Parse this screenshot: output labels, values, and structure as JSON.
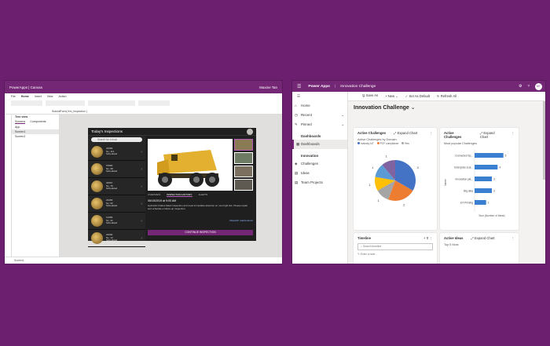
{
  "studio": {
    "title": "PowerApps | Canvas",
    "user": "Maxine Tan",
    "menu": [
      "File",
      "Home",
      "Insert",
      "View",
      "Action"
    ],
    "formula": "SubmitForm( frm_Inspection )",
    "tree_title": "Tree view",
    "tree_tabs": [
      "Screens",
      "Components"
    ],
    "tree_items": [
      "App",
      "Screen1",
      "Screen2"
    ],
    "status_left": "Screen1",
    "app": {
      "header": "Today's Inspections",
      "search_placeholder": "Search for a truck",
      "list": [
        {
          "id": "23456",
          "line1": "No. 114",
          "line2": "Scheduled"
        },
        {
          "id": "67890",
          "line1": "No. 98",
          "line2": "Scheduled"
        },
        {
          "id": "34567",
          "line1": "No. 76",
          "line2": "Scheduled"
        },
        {
          "id": "23456",
          "line1": "No. 52",
          "line2": "Scheduled"
        },
        {
          "id": "13456",
          "line1": "No. 31",
          "line2": "Scheduled"
        },
        {
          "id": "24690",
          "line1": "No. 12",
          "line2": "Scheduled"
        }
      ],
      "tabs": [
        "OVERVIEW",
        "INSPECTION HISTORY",
        "ALERTS"
      ],
      "datetime": "06/15/2019 at 9:00 AM",
      "description": "Hydraulic brakes failed inspection and need immediate attention on next rigid site. Please repair and schedule a follow-up inspection.",
      "details_link": "Dispatch maintenance",
      "continue_label": "CONTINUE INSPECTION"
    }
  },
  "modeldriven": {
    "brand": "Power Apps",
    "app_name": "Innovation Challenge",
    "avatar": "MT",
    "nav": {
      "top": [
        "Home",
        "Recent",
        "Pinned"
      ],
      "group1": "Dashboards",
      "group1_items": [
        "Dashboards"
      ],
      "group2": "Innovation",
      "group2_items": [
        "Challenges",
        "Ideas",
        "Team Projects"
      ]
    },
    "commands": [
      "Save As",
      "New",
      "Set As Default",
      "Refresh All"
    ],
    "dashboard_title": "Innovation Challenge",
    "card1": {
      "title": "Active Challenges",
      "expand": "Expand Chart",
      "subtitle": "Active Challenges by Domain",
      "legend": [
        "Industry IoT",
        "PCF compliance",
        "Res"
      ]
    },
    "card2": {
      "title": "Active Challenges",
      "expand": "Expand Chart",
      "subtitle": "Most popular Challenges",
      "ylabel": "Name",
      "xlabel": "Sum (Number of Ideas)"
    },
    "card3": {
      "title": "Timeline",
      "search_placeholder": "Search timeline",
      "note_placeholder": "Enter a note..."
    },
    "card4": {
      "title": "Active Ideas",
      "expand": "Expand Chart",
      "subtitle": "Top 5 Most"
    },
    "colors": {
      "accent": "#742774",
      "pie": [
        "#4472c4",
        "#ed7d31",
        "#a5a5a5",
        "#ffc000",
        "#5b9bd5",
        "#8064a2"
      ]
    }
  },
  "chart_data": [
    {
      "type": "pie",
      "title": "Active Challenges by Domain",
      "categories": [
        "Industry IoT",
        "PCF compliance",
        "Res",
        "",
        "",
        ""
      ],
      "values": [
        3,
        2,
        1,
        1,
        1,
        1
      ],
      "labels": [
        "3",
        "2",
        "1",
        "1",
        "1",
        "1"
      ]
    },
    {
      "type": "bar",
      "title": "Most popular Challenges",
      "categories": [
        "Connected Sp...",
        "Enterprise scal...",
        "Innovation pla...",
        "Big data",
        "IoT Printing"
      ],
      "values": [
        5,
        4,
        3,
        3,
        2
      ],
      "xlabel": "Sum (Number of Ideas)",
      "ylabel": "Name",
      "xlim": [
        0,
        6
      ]
    }
  ]
}
